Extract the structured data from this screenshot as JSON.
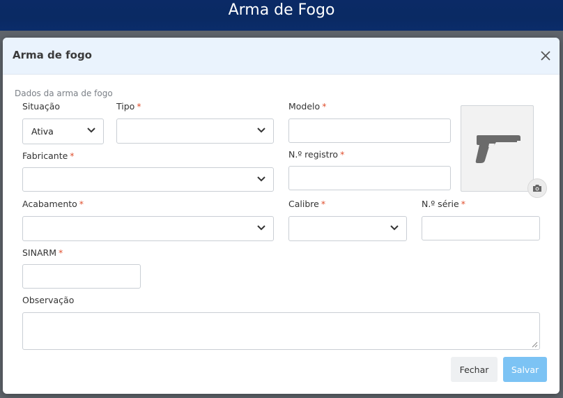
{
  "page": {
    "title": "Arma de Fogo"
  },
  "modal": {
    "title": "Arma de fogo",
    "section_label": "Dados da arma de fogo",
    "fields": {
      "situacao": {
        "label": "Situação",
        "value": "Ativa",
        "required": ""
      },
      "tipo": {
        "label": "Tipo",
        "value": "",
        "required": "*"
      },
      "modelo": {
        "label": "Modelo",
        "value": "",
        "required": "*"
      },
      "fabricante": {
        "label": "Fabricante",
        "value": "",
        "required": "*"
      },
      "registro": {
        "label": "N.º registro",
        "value": "",
        "required": "*"
      },
      "acabamento": {
        "label": "Acabamento",
        "value": "",
        "required": "*"
      },
      "calibre": {
        "label": "Calibre",
        "value": "",
        "required": "*"
      },
      "serie": {
        "label": "N.º série",
        "value": "",
        "required": "*"
      },
      "sinarm": {
        "label": "SINARM",
        "value": "",
        "required": "*"
      },
      "observacao": {
        "label": "Observação",
        "value": ""
      }
    },
    "buttons": {
      "close": "Fechar",
      "save": "Salvar"
    }
  },
  "icons": {
    "close": "close-icon",
    "chevron": "chevron-down-icon",
    "pistol": "pistol-icon",
    "camera": "camera-icon"
  },
  "colors": {
    "header_bg": "#0b2a66",
    "modal_header_bg": "#eaf3fd",
    "required": "#e0502f",
    "save_button": "#7cc3f4"
  }
}
